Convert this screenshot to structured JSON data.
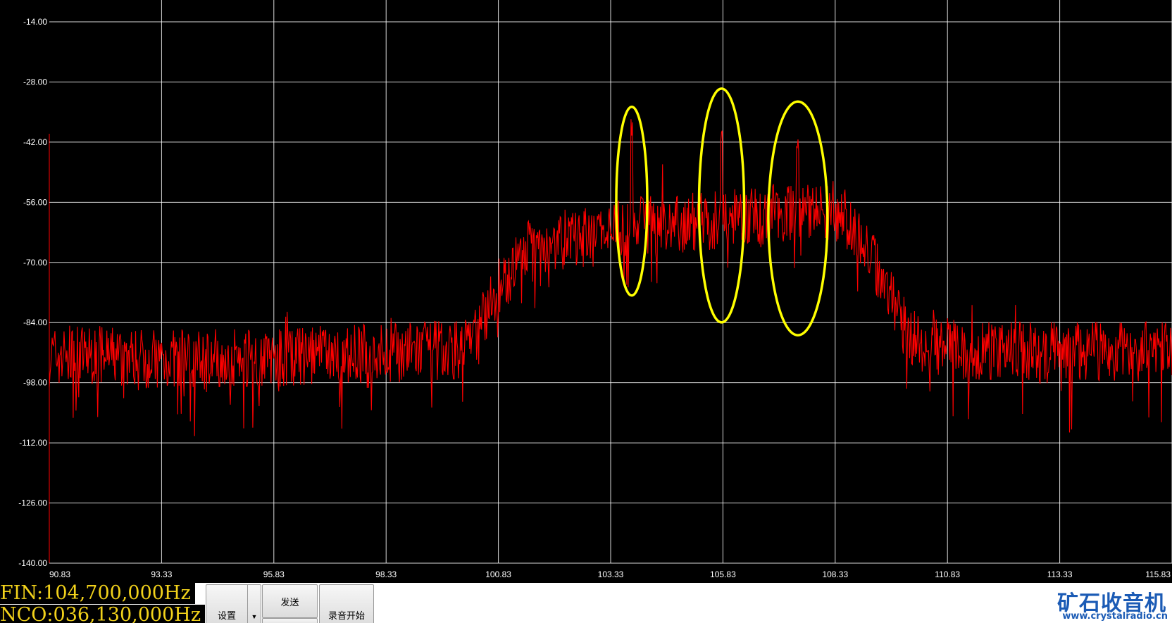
{
  "chart_data": {
    "type": "line",
    "xlabel": "",
    "ylabel": "",
    "xlim": [
      90.83,
      115.83
    ],
    "ylim": [
      -140,
      -14
    ],
    "x_ticks": [
      "90.83",
      "93.33",
      "95.83",
      "98.33",
      "100.83",
      "103.33",
      "105.83",
      "108.33",
      "110.83",
      "113.33",
      "115.83"
    ],
    "y_ticks": [
      "-14.00",
      "-28.00",
      "-42.00",
      "-56.00",
      "-70.00",
      "-84.00",
      "-98.00",
      "-112.00",
      "-126.00",
      "-140.00"
    ],
    "grid": true,
    "series": [
      {
        "color": "#ff0000",
        "x": [
          90.83,
          91.5,
          92.5,
          93.33,
          94.5,
          95.83,
          97,
          98.33,
          99.5,
          100.0,
          100.3,
          100.83,
          101.5,
          102.0,
          103.0,
          103.33,
          104.0,
          104.8,
          105.83,
          106.5,
          107.3,
          108.0,
          108.33,
          108.8,
          109.3,
          110.0,
          110.83,
          112.0,
          113.33,
          114.5,
          115.83
        ],
        "y": [
          -92,
          -91.5,
          -92,
          -92.5,
          -92,
          -92.5,
          -91.5,
          -91,
          -90.5,
          -90,
          -87,
          -76,
          -67,
          -65,
          -64,
          -63,
          -61,
          -61,
          -60,
          -59,
          -58,
          -58,
          -58,
          -62,
          -72,
          -88,
          -90,
          -90.5,
          -91,
          -90.5,
          -91
        ]
      }
    ],
    "peaks": [
      {
        "x": 103.8,
        "y": -41
      },
      {
        "x": 105.8,
        "y": -42
      },
      {
        "x": 107.5,
        "y": -45
      }
    ],
    "highlight_color": "#ffff00",
    "grid_color": "#ffffff",
    "label_color": "#ffffff"
  },
  "readouts": {
    "fin": "FIN:104,700,000Hz",
    "nco": "NCO:036,130,000Hz"
  },
  "toolbar": {
    "settings_label": "设置",
    "send_label": "发送",
    "record_label": "录音开始"
  },
  "brand": {
    "logo_text": "矿石收音机",
    "url": "www.crystalradio.cn"
  }
}
